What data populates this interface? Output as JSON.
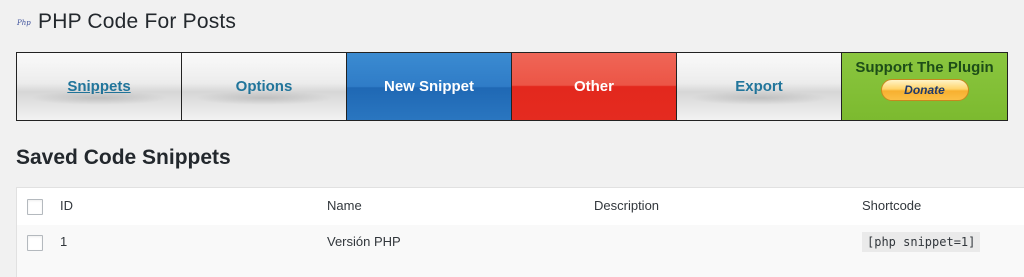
{
  "header": {
    "logo_icon": "php-logo-icon",
    "title": "PHP Code For Posts"
  },
  "nav": {
    "snippets_label": "Snippets",
    "options_label": "Options",
    "new_snippet_label": "New Snippet",
    "other_label": "Other",
    "export_label": "Export",
    "support_label": "Support The Plugin",
    "donate_label": "Donate"
  },
  "colors": {
    "link_blue": "#21759b",
    "new_snippet_bg": "#2f7cc7",
    "other_bg": "#e42b20",
    "support_bg": "#7cba2f"
  },
  "section_title": "Saved Code Snippets",
  "table": {
    "columns": [
      "ID",
      "Name",
      "Description",
      "Shortcode"
    ],
    "rows": [
      {
        "id": "1",
        "name": "Versión PHP",
        "description": "",
        "shortcode": "[php snippet=1]"
      }
    ]
  }
}
